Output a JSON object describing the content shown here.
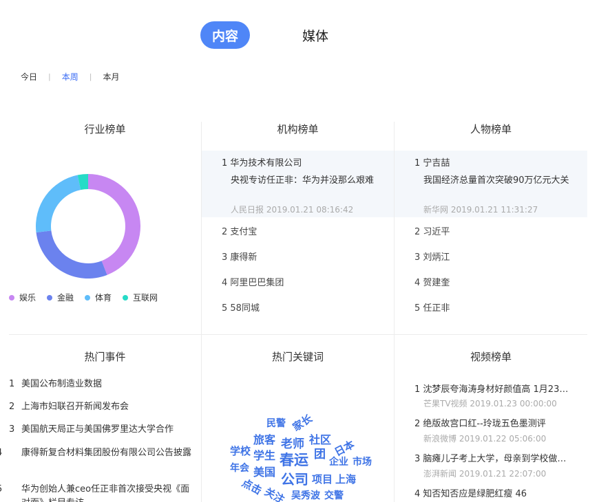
{
  "top_tabs": {
    "active": "内容",
    "other": "媒体"
  },
  "range": {
    "today": "今日",
    "week": "本周",
    "month": "本月",
    "sep": "|"
  },
  "industry": {
    "title": "行业榜单",
    "segments": [
      {
        "name": "娱乐",
        "value": 41,
        "color": "#c787f2"
      },
      {
        "name": "金融",
        "value": 27,
        "color": "#6b82ee"
      },
      {
        "name": "体育",
        "value": 22,
        "color": "#5fbdfa"
      },
      {
        "name": "互联网",
        "value": 3,
        "color": "#26dbc7"
      }
    ]
  },
  "org": {
    "title": "机构榜单",
    "top": {
      "rank": "1 华为技术有限公司",
      "headline": "央视专访任正非：华为并没那么艰难",
      "source": "人民日报 2019.01.21 08:16:42"
    },
    "items": [
      "2 支付宝",
      "3 康得新",
      "4 阿里巴巴集团",
      "5 58同城"
    ]
  },
  "person": {
    "title": "人物榜单",
    "top": {
      "rank": "1 宁吉喆",
      "headline": "我国经济总量首次突破90万亿元大关",
      "source": "新华网 2019.01.21 11:31:27"
    },
    "items": [
      "2 习近平",
      "3 刘炳江",
      "4 贺建奎",
      "5 任正非"
    ]
  },
  "events": {
    "title": "热门事件",
    "items": [
      {
        "n": "1",
        "text": "美国公布制造业数据"
      },
      {
        "n": "2",
        "text": "上海市妇联召开新闻发布会"
      },
      {
        "n": "3",
        "text": "美国航天局正与美国佛罗里达大学合作"
      },
      {
        "n": "4",
        "text": "康得新复合材料集团股份有限公司公告披露"
      },
      {
        "n": "5",
        "text": "华为创始人兼ceo任正非首次接受央视《面对面》栏目专访"
      }
    ]
  },
  "keywords": {
    "title": "热门关键词",
    "words": [
      "民警",
      "家长",
      "旅客",
      "老师",
      "社区",
      "日本",
      "学校",
      "学生",
      "春运",
      "团",
      "企业",
      "市场",
      "年会",
      "美国",
      "公司",
      "项目",
      "上海",
      "点击",
      "关注",
      "吴秀波",
      "交警"
    ]
  },
  "videos": {
    "title": "视频榜单",
    "items": [
      {
        "title": "1 沈梦辰夸海涛身材好颜值高 1月23…",
        "source": "芒果TV视频 2019.01.23 00:00:00"
      },
      {
        "title": "2 绝版故宫口红--玲珑五色墨测评",
        "source": "新浪微博 2019.01.22 05:06:00"
      },
      {
        "title": "3 脑瘫儿子考上大学，母亲到学校做…",
        "source": "澎湃新闻 2019.01.21 22:07:00"
      },
      {
        "title": "4 知否知否应是绿肥红瘦 46",
        "source": ""
      }
    ]
  }
}
